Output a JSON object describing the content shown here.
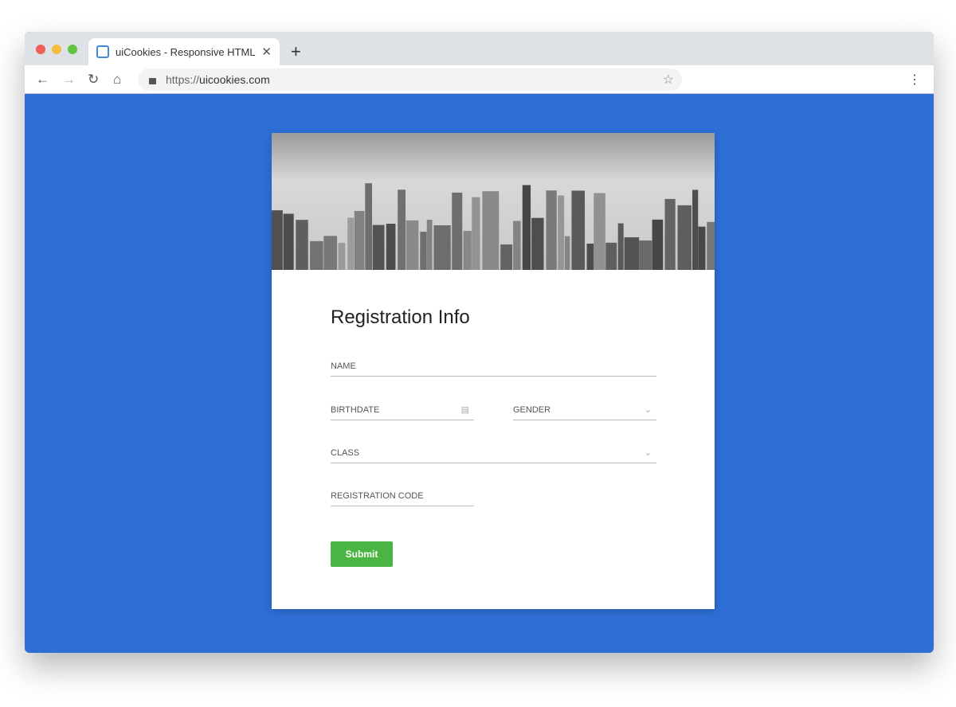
{
  "browser": {
    "tab_title": "uiCookies - Responsive HTML",
    "url_prefix": "https://",
    "url_domain": "uicookies.com"
  },
  "colors": {
    "background": "#2e6fd6",
    "submit": "#4bb543"
  },
  "form": {
    "title": "Registration Info",
    "fields": [
      {
        "label": "NAME"
      },
      {
        "label": "BIRTHDATE",
        "icon": "calendar-icon"
      },
      {
        "label": "GENDER",
        "icon": "chevron-down-icon"
      },
      {
        "label": "CLASS",
        "icon": "chevron-down-icon"
      },
      {
        "label": "REGISTRATION CODE"
      }
    ],
    "submit_label": "Submit"
  }
}
